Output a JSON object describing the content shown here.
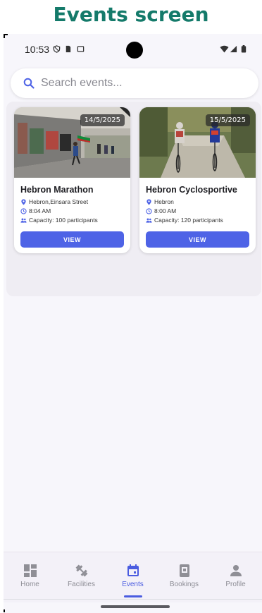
{
  "caption": "Events screen",
  "status": {
    "time": "10:53"
  },
  "search": {
    "placeholder": "Search events..."
  },
  "events": [
    {
      "title": "Hebron Marathon",
      "date": "14/5/2025",
      "location": "Hebron,Einsara Street",
      "time": "8:04 AM",
      "capacity": "Capacity: 100 participants",
      "button": "VIEW"
    },
    {
      "title": "Hebron Cyclosportive",
      "date": "15/5/2025",
      "location": "Hebron",
      "time": "8:00 AM",
      "capacity": "Capacity: 120 participants",
      "button": "VIEW"
    }
  ],
  "nav": [
    {
      "label": "Home",
      "icon": "dashboard-icon",
      "active": false
    },
    {
      "label": "Facilities",
      "icon": "fitness-icon",
      "active": false
    },
    {
      "label": "Events",
      "icon": "calendar-icon",
      "active": true
    },
    {
      "label": "Bookings",
      "icon": "bookings-icon",
      "active": false
    },
    {
      "label": "Profile",
      "icon": "person-icon",
      "active": false
    }
  ],
  "colors": {
    "accent": "#4e63e6",
    "caption": "#147a6a"
  }
}
